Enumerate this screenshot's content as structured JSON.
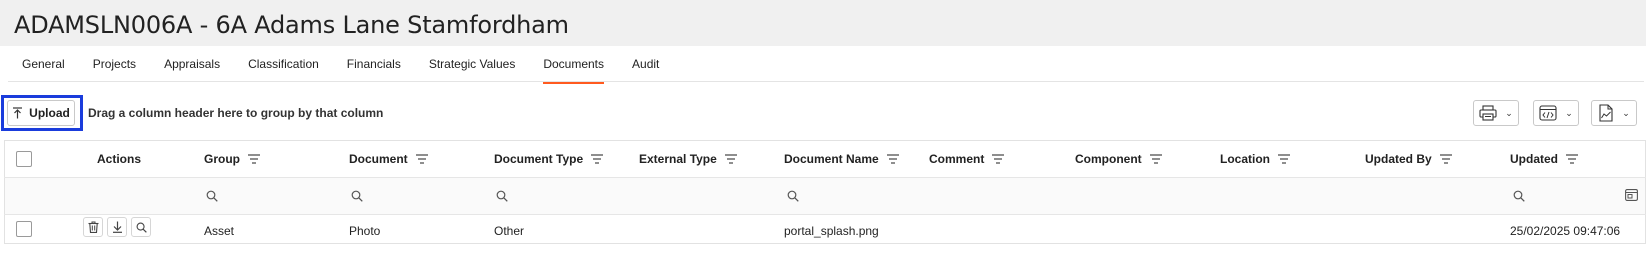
{
  "page": {
    "title": "ADAMSLN006A - 6A Adams Lane Stamfordham"
  },
  "tabs": [
    {
      "label": "General",
      "active": false
    },
    {
      "label": "Projects",
      "active": false
    },
    {
      "label": "Appraisals",
      "active": false
    },
    {
      "label": "Classification",
      "active": false
    },
    {
      "label": "Financials",
      "active": false
    },
    {
      "label": "Strategic Values",
      "active": false
    },
    {
      "label": "Documents",
      "active": true
    },
    {
      "label": "Audit",
      "active": false
    }
  ],
  "toolbar": {
    "upload_label": "Upload",
    "group_hint": "Drag a column header here to group by that column",
    "buttons": [
      {
        "name": "print",
        "icon": "printer-icon"
      },
      {
        "name": "export-xml",
        "icon": "code-window-icon"
      },
      {
        "name": "export-chart",
        "icon": "chart-document-icon"
      }
    ]
  },
  "grid": {
    "columns": [
      {
        "key": "actions",
        "label": "Actions",
        "filter": false,
        "search": false
      },
      {
        "key": "group",
        "label": "Group",
        "filter": true,
        "search": true
      },
      {
        "key": "document",
        "label": "Document",
        "filter": true,
        "search": true
      },
      {
        "key": "document_type",
        "label": "Document Type",
        "filter": true,
        "search": true
      },
      {
        "key": "external_type",
        "label": "External Type",
        "filter": true,
        "search": false
      },
      {
        "key": "document_name",
        "label": "Document Name",
        "filter": true,
        "search": true
      },
      {
        "key": "comment",
        "label": "Comment",
        "filter": true,
        "search": false
      },
      {
        "key": "component",
        "label": "Component",
        "filter": true,
        "search": false
      },
      {
        "key": "location",
        "label": "Location",
        "filter": true,
        "search": false
      },
      {
        "key": "updated_by",
        "label": "Updated By",
        "filter": true,
        "search": false
      },
      {
        "key": "updated",
        "label": "Updated",
        "filter": true,
        "search": true
      }
    ],
    "rows": [
      {
        "group": "Asset",
        "document": "Photo",
        "document_type": "Other",
        "external_type": "",
        "document_name": "portal_splash.png",
        "comment": "",
        "component": "",
        "location": "",
        "updated_by": "",
        "updated": "25/02/2025 09:47:06",
        "actions": [
          "delete-icon",
          "download-icon",
          "view-icon"
        ]
      }
    ]
  },
  "colors": {
    "accent": "#ff5a1f",
    "focus": "#1a3cdc"
  }
}
